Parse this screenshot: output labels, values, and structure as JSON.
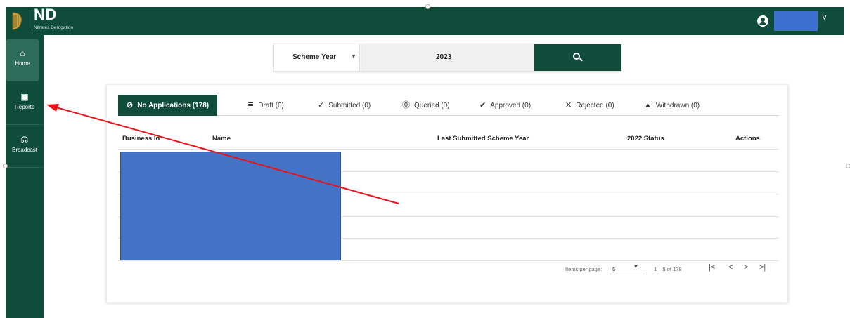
{
  "app": {
    "title": "ND",
    "subtitle": "Nitrates Derogation"
  },
  "header": {
    "user_icon": "account-circle-icon",
    "user_caret": "˅"
  },
  "sidebar": {
    "items": [
      {
        "label": "Home",
        "icon": "home-icon",
        "glyph": "⌂"
      },
      {
        "label": "Reports",
        "icon": "report-icon",
        "glyph": "▣"
      },
      {
        "label": "Broadcast",
        "icon": "broadcast-icon",
        "glyph": "☊"
      }
    ]
  },
  "filter": {
    "scheme_label": "Scheme Year",
    "year_value": "2023",
    "search_icon": "search-icon"
  },
  "tabs": [
    {
      "label": "No Applications (178)",
      "glyph": "⊘"
    },
    {
      "label": "Draft (0)",
      "glyph": "≣"
    },
    {
      "label": "Submitted (0)",
      "glyph": "✓"
    },
    {
      "label": "Queried (0)",
      "glyph": "⓪"
    },
    {
      "label": "Approved (0)",
      "glyph": "✔"
    },
    {
      "label": "Rejected (0)",
      "glyph": "✕"
    },
    {
      "label": "Withdrawn (0)",
      "glyph": "▲"
    }
  ],
  "table": {
    "headers": {
      "business_id": "Business Id",
      "name": "Name",
      "last_year": "Last Submitted Scheme Year",
      "status": "2022 Status",
      "actions": "Actions"
    }
  },
  "paginator": {
    "items_per_page_label": "Items per page:",
    "items_per_page_value": "5",
    "range": "1 – 5 of 178",
    "first": "|<",
    "prev": "<",
    "next": ">",
    "last": ">|"
  },
  "annotation": {
    "arrow_color": "#e8141c"
  },
  "colors": {
    "brand_green": "#0f4c3a",
    "redaction_blue": "#4472c4"
  }
}
